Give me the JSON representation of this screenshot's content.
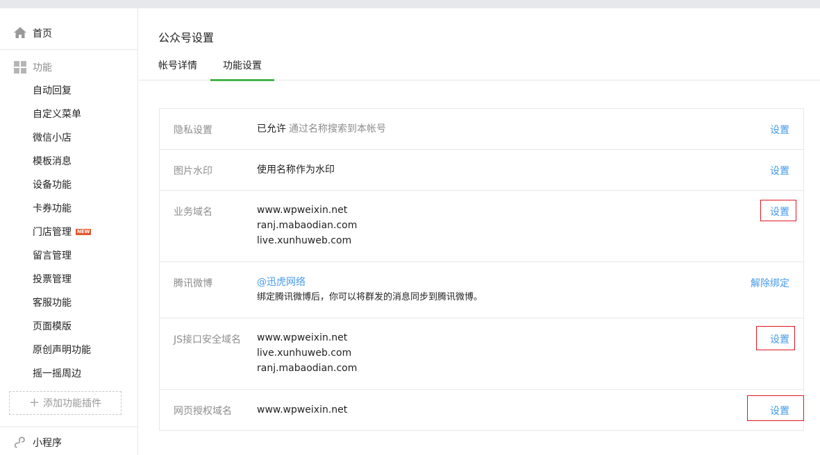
{
  "sidebar": {
    "home": "首页",
    "group_title": "功能",
    "items": [
      "自动回复",
      "自定义菜单",
      "微信小店",
      "模板消息",
      "设备功能",
      "卡券功能",
      "门店管理",
      "留言管理",
      "投票管理",
      "客服功能",
      "页面模版",
      "原创声明功能",
      "摇一摇周边"
    ],
    "new_badge": "NEW",
    "add_plugin": "添加功能插件",
    "mini_program": "小程序"
  },
  "main": {
    "page_title": "公众号设置",
    "tabs": [
      "帐号详情",
      "功能设置"
    ],
    "active_tab": "功能设置",
    "rows": [
      {
        "label": "隐私设置",
        "value": "已允许",
        "sub": "通过名称搜索到本帐号",
        "action": "设置"
      },
      {
        "label": "图片水印",
        "value": "使用名称作为水印",
        "action": "设置"
      },
      {
        "label": "业务域名",
        "lines": [
          "www.wpweixin.net",
          "ranj.mabaodian.com",
          "live.xunhuweb.com"
        ],
        "action": "设置"
      },
      {
        "label": "腾讯微博",
        "link": "@迅虎网络",
        "note": "绑定腾讯微博后，你可以将群发的消息同步到腾讯微博。",
        "action": "解除绑定"
      },
      {
        "label": "JS接口安全域名",
        "lines": [
          "www.wpweixin.net",
          "live.xunhuweb.com",
          "ranj.mabaodian.com"
        ],
        "action": "设置"
      },
      {
        "label": "网页授权域名",
        "value": "www.wpweixin.net",
        "action": "设置"
      }
    ]
  },
  "colors": {
    "accent_green": "#44b549",
    "link_blue": "#459ae9",
    "highlight_red": "#e0141e",
    "new_badge": "#e2582e"
  },
  "icons": [
    "home-icon",
    "grid-icon",
    "mini-program-icon",
    "plus-icon"
  ]
}
